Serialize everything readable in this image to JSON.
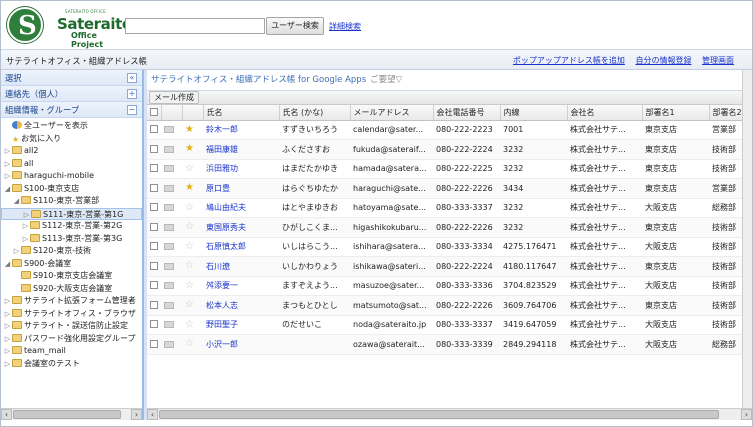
{
  "logo": {
    "letter": "S",
    "brand": "Sateraito",
    "subbrand": "Office Project",
    "tagline": "SATERAITO OFFICE"
  },
  "search": {
    "value": "",
    "button": "ユーザー検索",
    "advanced": "詳細検索"
  },
  "title": "サテライトオフィス・組織アドレス帳",
  "links": [
    "ポップアップアドレス帳を追加",
    "自分の情報登録",
    "管理画面"
  ],
  "sidebar": {
    "sections": [
      {
        "label": "選択",
        "pm": "«"
      },
      {
        "label": "連絡先（個人）",
        "pm": "+"
      },
      {
        "label": "組織情報・グループ",
        "pm": "−"
      }
    ],
    "tree": [
      {
        "label": "全ユーザーを表示",
        "icon": "people",
        "tw": "",
        "indent": 0
      },
      {
        "label": "お気に入り",
        "icon": "star",
        "tw": "",
        "indent": 0
      },
      {
        "label": "all2",
        "icon": "folder",
        "tw": "▷",
        "indent": 0
      },
      {
        "label": "all",
        "icon": "folder",
        "tw": "▷",
        "indent": 0
      },
      {
        "label": "haraguchi-mobile",
        "icon": "folder",
        "tw": "▷",
        "indent": 0
      },
      {
        "label": "S100-東京支店",
        "icon": "folder",
        "tw": "◢",
        "indent": 0
      },
      {
        "label": "S110-東京-営業部",
        "icon": "folder",
        "tw": "◢",
        "indent": 1
      },
      {
        "label": "S111-東京-営業-第1G",
        "icon": "folder",
        "tw": "▷",
        "indent": 2,
        "selected": true
      },
      {
        "label": "S112-東京-営業-第2G",
        "icon": "folder",
        "tw": "▷",
        "indent": 2
      },
      {
        "label": "S113-東京-営業-第3G",
        "icon": "folder",
        "tw": "▷",
        "indent": 2
      },
      {
        "label": "S120-東京-技術",
        "icon": "folder",
        "tw": "▷",
        "indent": 1
      },
      {
        "label": "S900-会議室",
        "icon": "folder",
        "tw": "◢",
        "indent": 0
      },
      {
        "label": "S910-東京支店会議室",
        "icon": "folder",
        "tw": "",
        "indent": 1
      },
      {
        "label": "S920-大阪支店会議室",
        "icon": "folder",
        "tw": "",
        "indent": 1
      },
      {
        "label": "サテライト拡張フォーム管理者",
        "icon": "folder",
        "tw": "▷",
        "indent": 0
      },
      {
        "label": "サテライトオフィス・ブラウザ",
        "icon": "folder",
        "tw": "▷",
        "indent": 0
      },
      {
        "label": "サテライト・誤送信防止設定",
        "icon": "folder",
        "tw": "▷",
        "indent": 0
      },
      {
        "label": "パスワード強化用設定グループ",
        "icon": "folder",
        "tw": "▷",
        "indent": 0
      },
      {
        "label": "team_mail",
        "icon": "folder",
        "tw": "▷",
        "indent": 0
      },
      {
        "label": "会議室のテスト",
        "icon": "folder",
        "tw": "▷",
        "indent": 0
      }
    ]
  },
  "main": {
    "header": "サテライトオフィス・組織アドレス帳 for Google Apps",
    "option": "ご要望▽",
    "toolbar": "メール作成",
    "columns": [
      "",
      "",
      "",
      "氏名",
      "氏名 (かな)",
      "メールアドレス",
      "会社電話番号",
      "内線",
      "会社名",
      "部署名1",
      "部署名2"
    ],
    "rows": [
      [
        "鈴木一郎",
        "すずきいちろう",
        "calendar@sater...",
        "080-222-2223",
        "7001",
        "株式会社サテ...",
        "東京支店",
        "営業部",
        true
      ],
      [
        "福田康雄",
        "ふくださすお",
        "fukuda@sateraif...",
        "080-222-2224",
        "3232",
        "株式会社サテ...",
        "東京支店",
        "技術部",
        true
      ],
      [
        "浜田雅功",
        "はまだたかゆき",
        "hamada@satera...",
        "080-222-2225",
        "3232",
        "株式会社サテ...",
        "東京支店",
        "技術部",
        false
      ],
      [
        "原口豊",
        "はらぐちゆたか",
        "haraguchi@sate...",
        "080-222-2226",
        "3434",
        "株式会社サテ...",
        "東京支店",
        "営業部",
        true
      ],
      [
        "鳩山由紀夫",
        "はとやまゆきお",
        "hatoyama@sate...",
        "080-333-3337",
        "3232",
        "株式会社サテ...",
        "大阪支店",
        "総務部",
        false
      ],
      [
        "東国原秀夫",
        "ひがしこくま...",
        "higashikokubaru...",
        "080-222-2226",
        "3232",
        "株式会社サテ...",
        "東京支店",
        "技術部",
        false
      ],
      [
        "石原慎太郎",
        "いしはらこう...",
        "ishihara@satera...",
        "080-333-3334",
        "4275.176471",
        "株式会社サテ...",
        "大阪支店",
        "技術部",
        false
      ],
      [
        "石川遼",
        "いしかわりょう",
        "ishikawa@sateri...",
        "080-222-2224",
        "4180.117647",
        "株式会社サテ...",
        "東京支店",
        "技術部",
        false
      ],
      [
        "舛添要一",
        "ますぞえよう...",
        "masuzoe@sater...",
        "080-333-3336",
        "3704.823529",
        "株式会社サテ...",
        "大阪支店",
        "技術部",
        false
      ],
      [
        "松本人志",
        "まつもとひとし",
        "matsumoto@sat...",
        "080-222-2226",
        "3609.764706",
        "株式会社サテ...",
        "東京支店",
        "技術部",
        false
      ],
      [
        "野田聖子",
        "のだせいこ",
        "noda@sateraito.jp",
        "080-333-3337",
        "3419.647059",
        "株式会社サテ...",
        "大阪支店",
        "技術部",
        false
      ],
      [
        "小沢一郎",
        "",
        "ozawa@saterait...",
        "080-333-3339",
        "2849.294118",
        "株式会社サテ...",
        "大阪支店",
        "総務部",
        false
      ]
    ]
  }
}
